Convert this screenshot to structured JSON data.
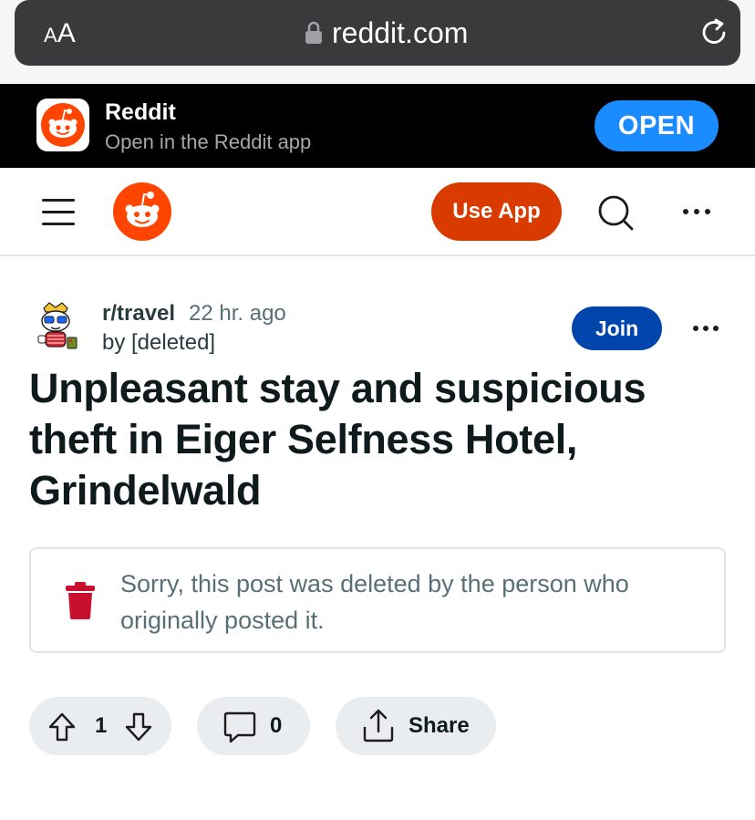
{
  "browser": {
    "aa_label_big": "A",
    "aa_label_small": "A",
    "url": "reddit.com"
  },
  "banner": {
    "app_name": "Reddit",
    "subtitle": "Open in the Reddit app",
    "open_label": "OPEN"
  },
  "header": {
    "use_app_label": "Use App"
  },
  "post": {
    "subreddit": "r/travel",
    "time": "22 hr. ago",
    "author_line": "by [deleted]",
    "join_label": "Join",
    "title": "Unpleasant stay and suspicious theft in Eiger Selfness Hotel, Grindelwald",
    "deleted_notice": "Sorry, this post was deleted by the person who originally posted it.",
    "vote_count": "1",
    "comment_count": "0",
    "share_label": "Share"
  },
  "colors": {
    "reddit_orange": "#ff4500",
    "use_app_bg": "#d93a00",
    "join_bg": "#0045ac",
    "open_bg": "#1a8cff",
    "trash_red": "#c8102e"
  },
  "icons": [
    "lock-icon",
    "reload-icon",
    "reddit-app-icon",
    "hamburger-icon",
    "reddit-logo-icon",
    "search-icon",
    "more-icon",
    "subreddit-avatar-icon",
    "trash-icon",
    "upvote-icon",
    "downvote-icon",
    "comment-icon",
    "share-icon"
  ]
}
